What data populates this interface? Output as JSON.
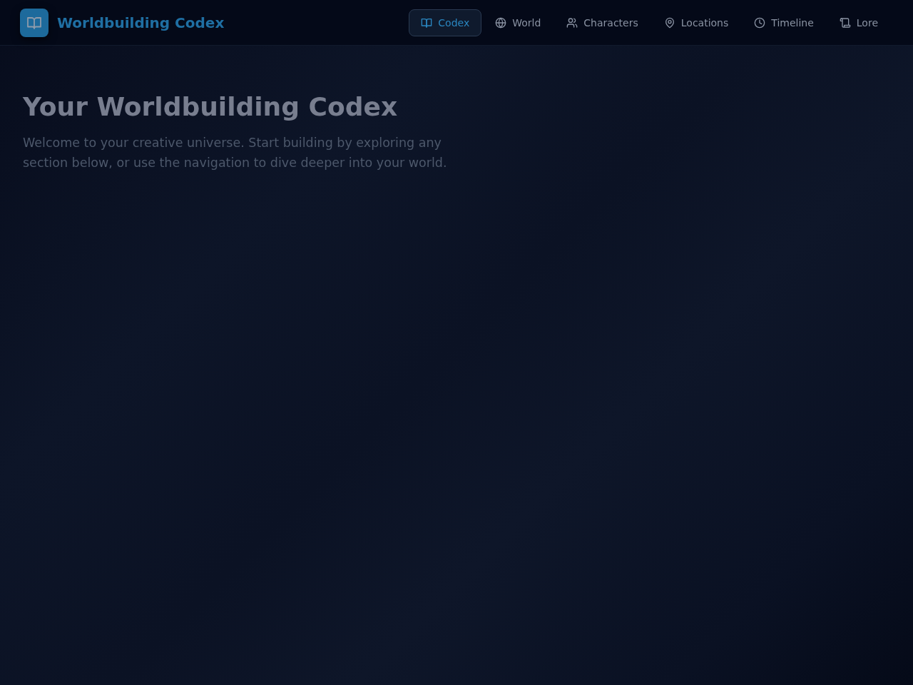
{
  "header": {
    "title": "Worldbuilding Codex"
  },
  "nav": [
    {
      "label": "Codex",
      "kind": "book",
      "selected": true
    },
    {
      "label": "World",
      "kind": "globe",
      "selected": false
    },
    {
      "label": "Characters",
      "kind": "people",
      "selected": false
    },
    {
      "label": "Locations",
      "kind": "pin",
      "selected": false
    },
    {
      "label": "Timeline",
      "kind": "clock",
      "selected": false
    },
    {
      "label": "Lore",
      "kind": "scroll",
      "selected": false
    }
  ],
  "hero": {
    "title": "Your Worldbuilding Codex",
    "text": "Welcome to your creative universe. Start building by exploring any section below, or use the navigation to dive deeper into your world."
  }
}
